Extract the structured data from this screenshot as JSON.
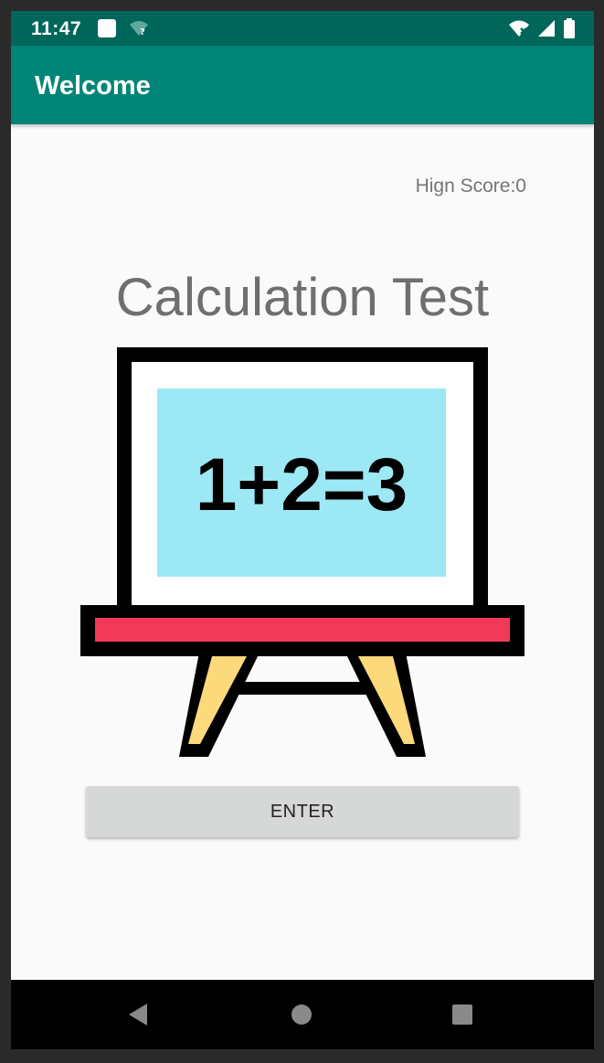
{
  "status_bar": {
    "time": "11:47",
    "icons": [
      "notification-square-icon",
      "wifi-unknown-icon",
      "wifi-off-icon",
      "cell-signal-icon",
      "battery-icon"
    ],
    "color": "#00665a"
  },
  "app_bar": {
    "title": "Welcome",
    "color": "#008577"
  },
  "main": {
    "high_score": "Hign Score:0",
    "title": "Calculation Test",
    "board_equation": "1+2=3",
    "enter_label": "ENTER"
  },
  "board_colors": {
    "frame": "#000000",
    "inner": "#ffffff",
    "panel": "#9de8f5",
    "shelf": "#f2395a",
    "legs": "#fcd97b"
  },
  "nav_bar": {
    "buttons": [
      "back-icon",
      "home-icon",
      "recents-icon"
    ]
  }
}
